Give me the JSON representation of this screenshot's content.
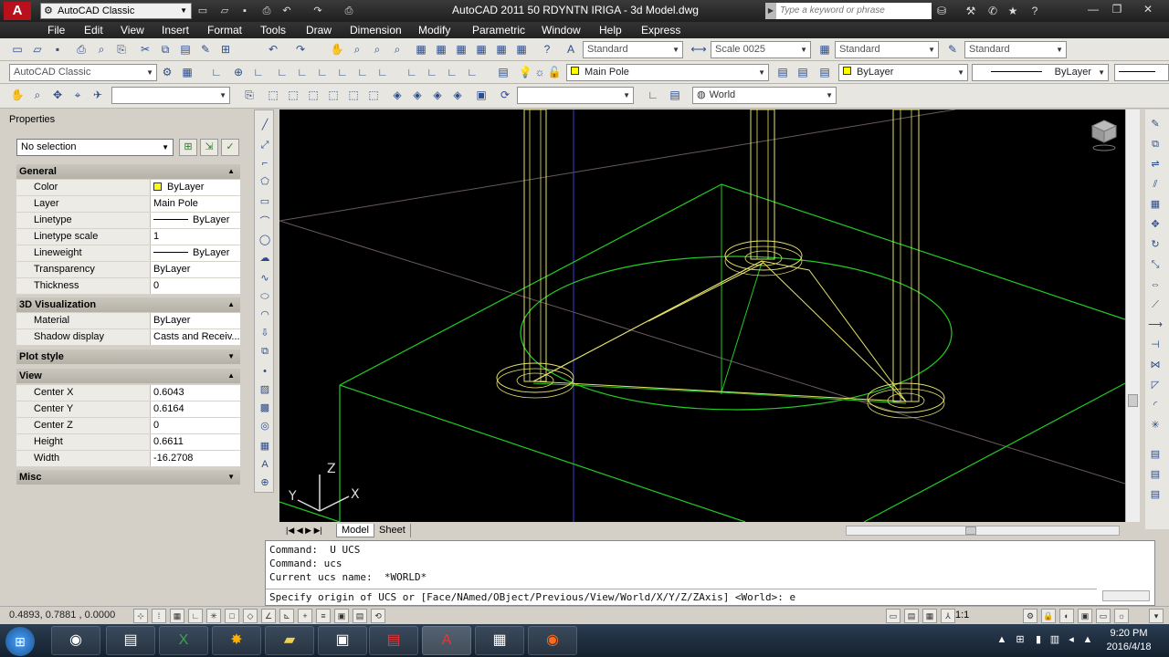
{
  "titlebar": {
    "app_logo": "A",
    "workspace": "AutoCAD Classic",
    "document_title": "AutoCAD 2011   50 RDYNTN IRIGA - 3d Model.dwg",
    "search_placeholder": "Type a keyword or phrase"
  },
  "menu": [
    "File",
    "Edit",
    "View",
    "Insert",
    "Format",
    "Tools",
    "Draw",
    "Dimension",
    "Modify",
    "Parametric",
    "Window",
    "Help",
    "Express"
  ],
  "toolbars": {
    "text_style": "Standard",
    "dim_style": "Scale 0025",
    "table_style": "Standard",
    "multileader_style": "Standard",
    "workspace_combo": "AutoCAD Classic",
    "layer": "Main Pole",
    "color": "ByLayer",
    "linetype": "ByLayer",
    "ucs": "World"
  },
  "properties": {
    "title": "Properties",
    "selection": "No selection",
    "sections": {
      "general": "General",
      "visualization": "3D Visualization",
      "plot_style": "Plot style",
      "view": "View",
      "misc": "Misc"
    },
    "general_rows": [
      {
        "label": "Color",
        "value": "ByLayer"
      },
      {
        "label": "Layer",
        "value": "Main Pole"
      },
      {
        "label": "Linetype",
        "value": "ByLayer"
      },
      {
        "label": "Linetype scale",
        "value": "1"
      },
      {
        "label": "Lineweight",
        "value": "ByLayer"
      },
      {
        "label": "Transparency",
        "value": "ByLayer"
      },
      {
        "label": "Thickness",
        "value": "0"
      }
    ],
    "visualization_rows": [
      {
        "label": "Material",
        "value": "ByLayer"
      },
      {
        "label": "Shadow display",
        "value": "Casts and Receiv..."
      }
    ],
    "view_rows": [
      {
        "label": "Center X",
        "value": "0.6043"
      },
      {
        "label": "Center Y",
        "value": "0.6164"
      },
      {
        "label": "Center Z",
        "value": "0"
      },
      {
        "label": "Height",
        "value": "0.6611"
      },
      {
        "label": "Width",
        "value": "-16.2708"
      }
    ]
  },
  "viewport": {
    "ucs_labels": {
      "z": "Z",
      "x": "X",
      "y": "Y"
    },
    "tabs": [
      "Model",
      "Sheet"
    ],
    "colors": {
      "background": "#000000",
      "green": "#22cc22",
      "yellow": "#e6e36a"
    }
  },
  "command_line": {
    "history": [
      "Command:  U UCS",
      "Command: ucs",
      "Current ucs name:  *WORLD*"
    ],
    "prompt": "Specify origin of UCS or [Face/NAmed/OBject/Previous/View/World/X/Y/Z/ZAxis] <World>: e"
  },
  "statusbar": {
    "coordinates": "0.4893, 0.7881 , 0.0000",
    "annotation_scale": "1:1"
  },
  "taskbar": {
    "time": "9:20 PM",
    "date": "2016/4/18"
  }
}
